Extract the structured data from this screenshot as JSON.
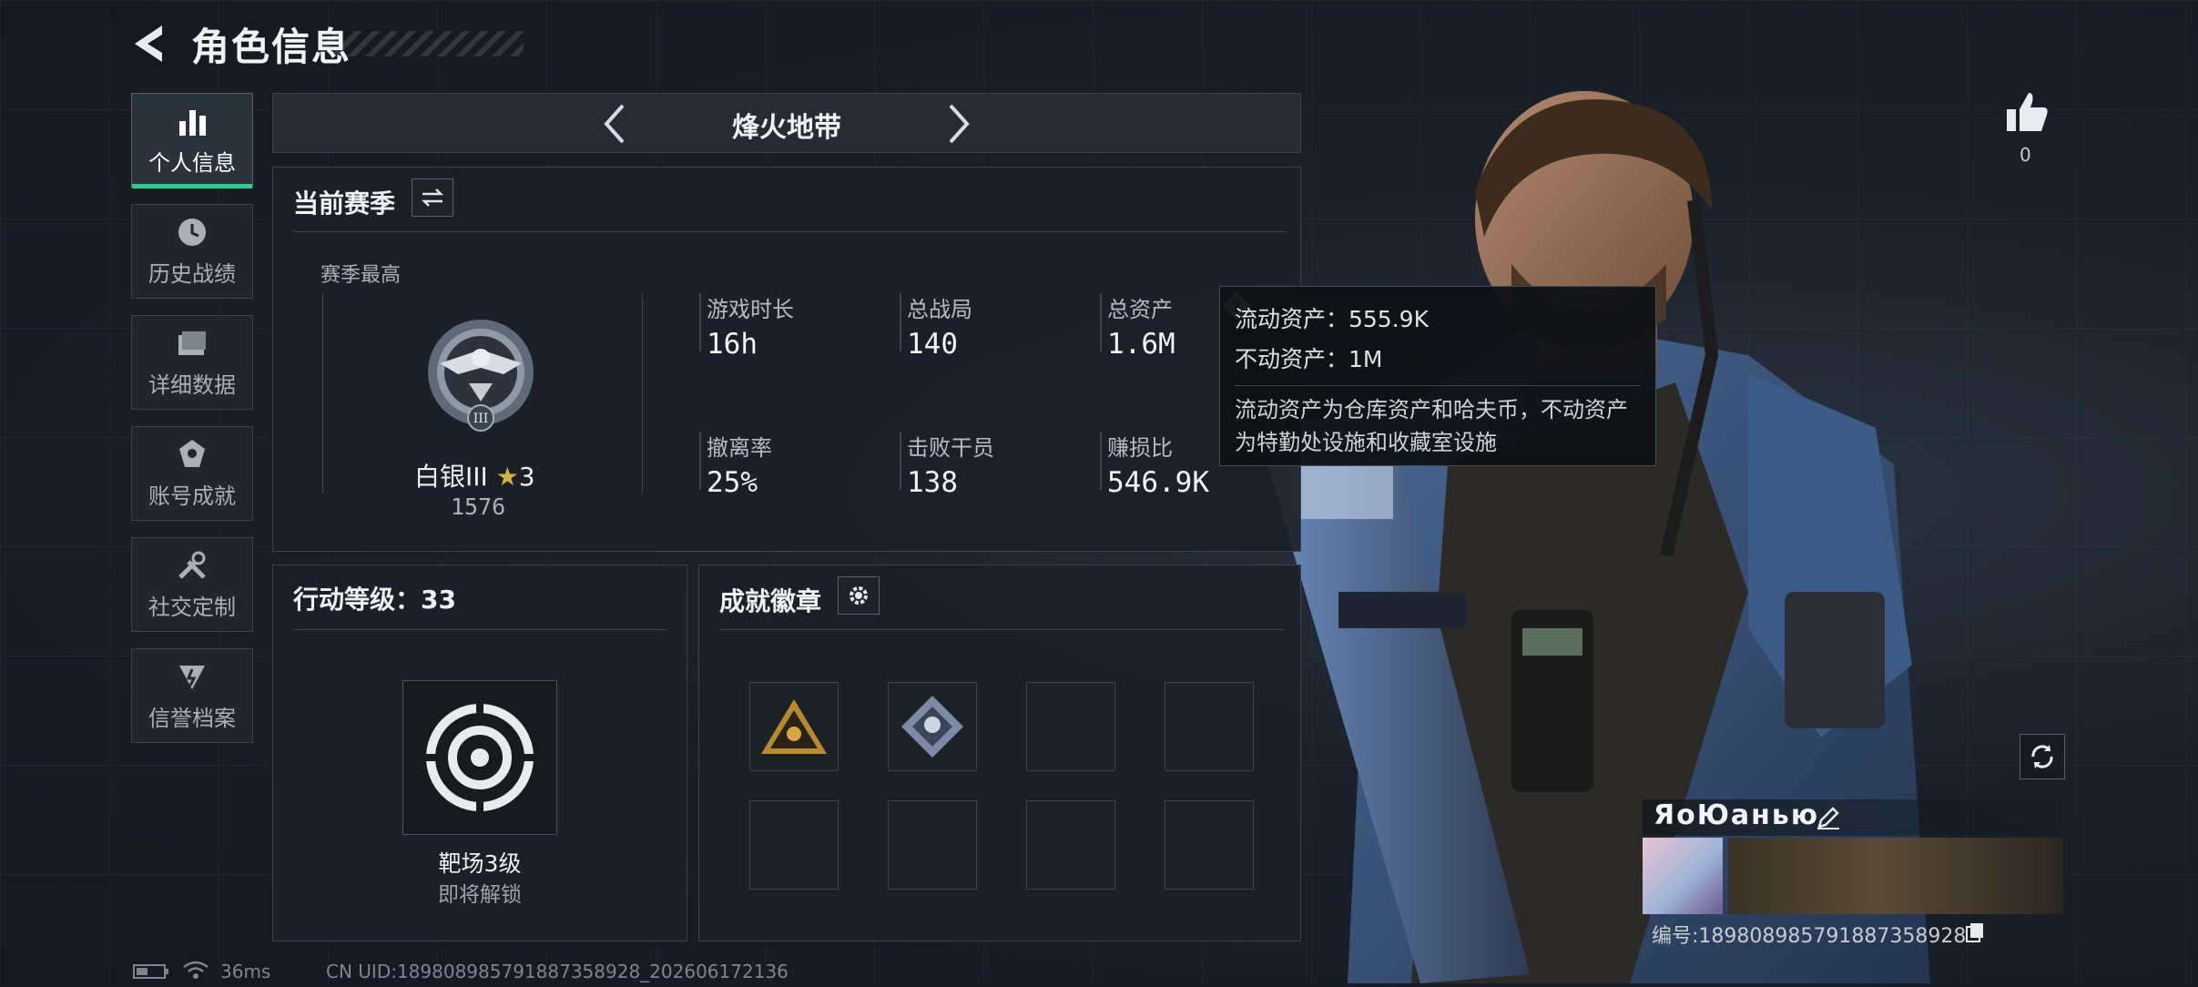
{
  "header": {
    "title": "角色信息"
  },
  "sidebar": {
    "items": [
      {
        "label": "个人信息",
        "icon": "bar-chart-icon",
        "active": true
      },
      {
        "label": "历史战绩",
        "icon": "clock-icon"
      },
      {
        "label": "详细数据",
        "icon": "folder-icon"
      },
      {
        "label": "账号成就",
        "icon": "achievement-icon"
      },
      {
        "label": "社交定制",
        "icon": "wrench-icon"
      },
      {
        "label": "信誉档案",
        "icon": "credit-icon"
      }
    ]
  },
  "mode": {
    "title": "烽火地带"
  },
  "season": {
    "title": "当前赛季",
    "peak_label": "赛季最高",
    "rank_name": "白银III",
    "rank_stars": "3",
    "rank_score": "1576",
    "stats": [
      {
        "label": "游戏时长",
        "value": "16h"
      },
      {
        "label": "总战局",
        "value": "140"
      },
      {
        "label": "总资产",
        "value": "1.6M"
      },
      {
        "label": "撤离率",
        "value": "25%"
      },
      {
        "label": "击败干员",
        "value": "138"
      },
      {
        "label": "赚损比",
        "value": "546.9K"
      }
    ]
  },
  "tooltip": {
    "liquid": "流动资产：555.9K",
    "fixed": "不动资产：1M",
    "desc": "流动资产为仓库资产和哈夫币，不动资产为特勤处设施和收藏室设施"
  },
  "level": {
    "title": "行动等级：33",
    "unlock_name": "靶场3级",
    "unlock_hint": "即将解锁"
  },
  "badges": {
    "title": "成就徽章"
  },
  "likes": {
    "count": "0"
  },
  "player": {
    "name": "ЯоЮанью",
    "id_text": "编号:18980898579188735892‍8"
  },
  "status": {
    "ping": "36ms",
    "uid": "CN UID:18980898579188735892‍8_202606172136"
  },
  "colors": {
    "accent": "#2ecc8a",
    "rank_star": "#d4b34a"
  }
}
